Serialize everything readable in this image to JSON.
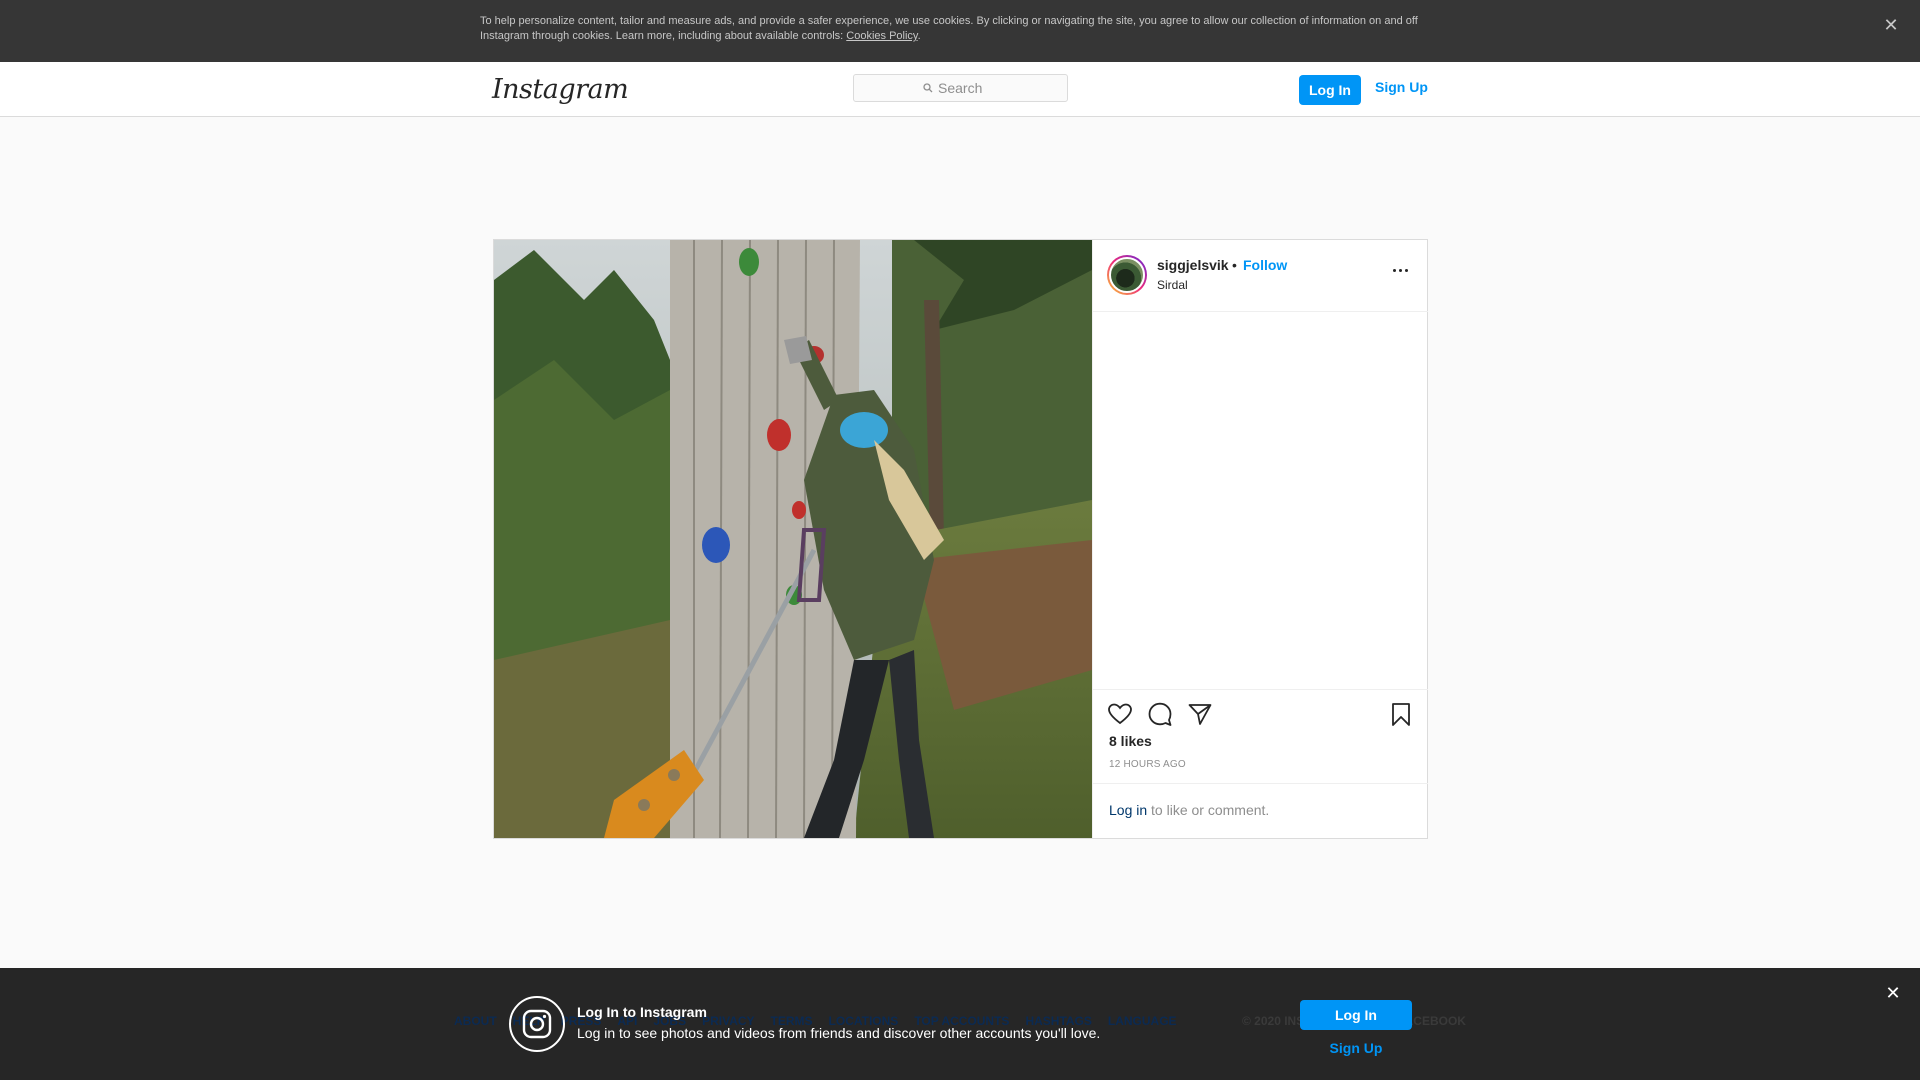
{
  "cookie_banner": {
    "text": "To help personalize content, tailor and measure ads, and provide a safer experience, we use cookies. By clicking or navigating the site, you agree to allow our collection of information on and off Instagram through cookies. Learn more, including about available controls: ",
    "link": "Cookies Policy",
    "after_link": ".",
    "close_icon": "close-icon"
  },
  "header": {
    "logo": "Instagram",
    "search_placeholder": "Search",
    "login_label": "Log In",
    "signup_label": "Sign Up"
  },
  "post": {
    "username": "siggjelsvik",
    "separator": "•",
    "follow_label": "Follow",
    "location": "Sirdal",
    "likes": "8 likes",
    "time_ago": "12 HOURS AGO",
    "comment_prompt_link": "Log in",
    "comment_prompt_rest": " to like or comment.",
    "icons": [
      "heart-icon",
      "comment-icon",
      "share-icon",
      "bookmark-icon",
      "more-icon"
    ]
  },
  "bottom_bar": {
    "title": "Log In to Instagram",
    "subtitle": "Log in to see photos and videos from friends and discover other accounts you'll love.",
    "login_label": "Log In",
    "signup_label": "Sign Up",
    "footer_links": [
      "ABOUT",
      "HELP",
      "PRESS",
      "API",
      "JOBS",
      "PRIVACY",
      "TERMS",
      "LOCATIONS",
      "TOP ACCOUNTS",
      "HASHTAGS",
      "LANGUAGE"
    ],
    "copyright": "© 2020 INSTAGRAM FROM FACEBOOK"
  },
  "colors": {
    "accent": "#0095f6",
    "banner_bg": "#363636",
    "bottom_bar_bg": "#262626",
    "page_bg": "#fafafa"
  }
}
